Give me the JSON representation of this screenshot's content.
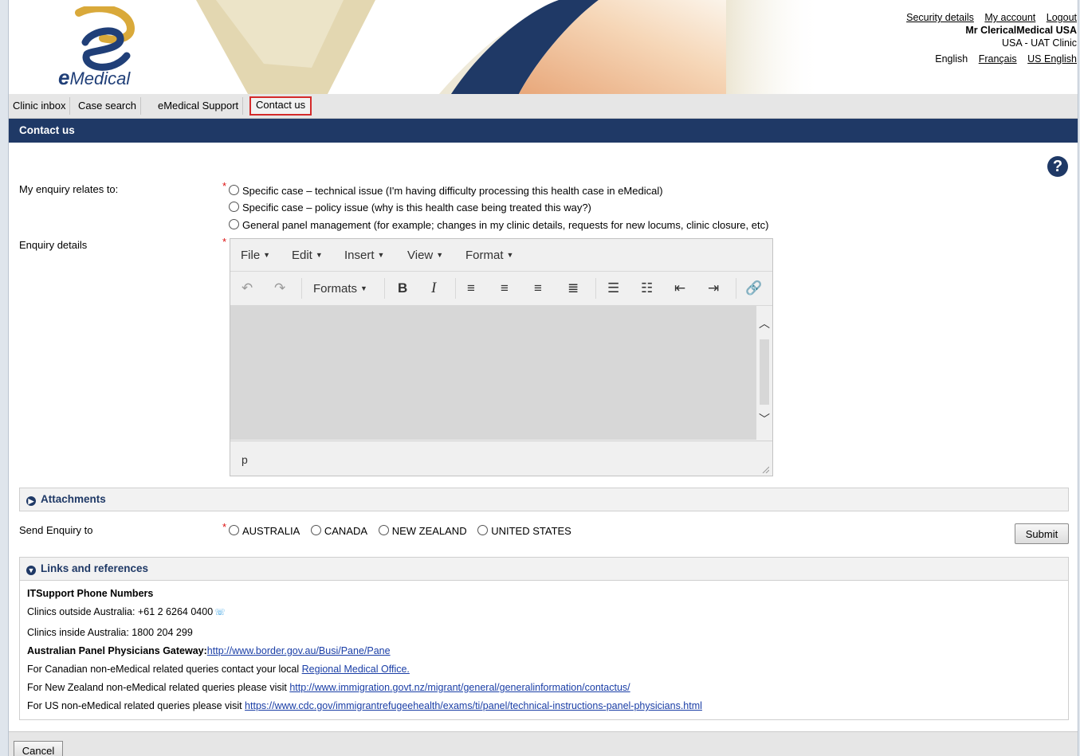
{
  "header": {
    "logo_text": "Medical",
    "logo_e": "e",
    "top_links": [
      "Security details",
      "My account",
      "Logout"
    ],
    "user_name": "Mr ClericalMedical USA",
    "clinic": "USA - UAT Clinic",
    "lang_current": "English",
    "lang_links": [
      "Français",
      "US English"
    ]
  },
  "nav": {
    "tabs": [
      {
        "label": "Clinic inbox"
      },
      {
        "label": "Case search"
      },
      {
        "label": "eMedical Support"
      },
      {
        "label": "Contact us"
      }
    ],
    "active": "Contact us"
  },
  "page_title": "Contact us",
  "help_glyph": "?",
  "form": {
    "required_marker": "*",
    "enquiry_label": "My enquiry relates to:",
    "enquiry_options": [
      "Specific case – technical issue (I'm having difficulty processing this health case in eMedical)",
      "Specific case – policy issue (why is this health case being treated this way?)",
      "General panel management (for example; changes in my clinic details, requests for new locums, clinic closure, etc)"
    ],
    "details_label": "Enquiry details",
    "editor": {
      "menus": [
        "File",
        "Edit",
        "Insert",
        "View",
        "Format"
      ],
      "formats_label": "Formats",
      "status_path": "p"
    },
    "attachments_label": "Attachments",
    "send_label": "Send Enquiry to",
    "countries": [
      "AUSTRALIA",
      "CANADA",
      "NEW ZEALAND",
      "UNITED STATES"
    ],
    "submit_label": "Submit"
  },
  "links": {
    "section_label": "Links and references",
    "phone_heading": "ITSupport Phone Numbers",
    "outside": "Clinics outside Australia: +61 2 6264 0400",
    "inside": "Clinics inside Australia: 1800 204 299",
    "gateway_label": "Australian Panel Physicians Gateway:",
    "gateway_url": "http://www.border.gov.au/Busi/Pane/Pane",
    "canada_text": "For Canadian non-eMedical related queries contact your local ",
    "canada_link": "Regional Medical Office.",
    "nz_text": "For New Zealand non-eMedical related queries please visit ",
    "nz_link": "http://www.immigration.govt.nz/migrant/general/generalinformation/contactus/",
    "us_text": "For US non-eMedical related queries please visit ",
    "us_link": "https://www.cdc.gov/immigrantrefugeehealth/exams/ti/panel/technical-instructions-panel-physicians.html"
  },
  "footer": {
    "cancel_label": "Cancel"
  },
  "colors": {
    "navy": "#1f3966",
    "link": "#1a3ea6",
    "required": "#d11111",
    "active_tab_border": "#d42a2a"
  }
}
